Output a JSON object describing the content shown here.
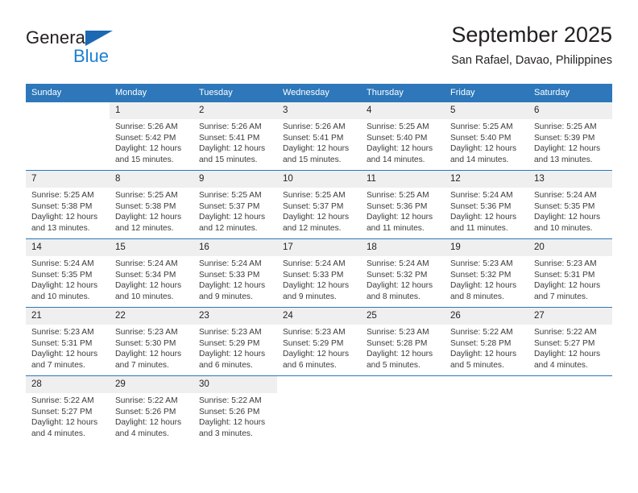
{
  "brand": {
    "name_top": "General",
    "name_bottom": "Blue",
    "triangle_color": "#1b69b3",
    "blue_color": "#1b7fd4"
  },
  "header": {
    "title": "September 2025",
    "subtitle": "San Rafael, Davao, Philippines"
  },
  "theme": {
    "header_bg": "#2d77ba",
    "daynum_bg": "#efefef",
    "text": "#231f20"
  },
  "weekdays": [
    "Sunday",
    "Monday",
    "Tuesday",
    "Wednesday",
    "Thursday",
    "Friday",
    "Saturday"
  ],
  "weeks": [
    [
      {
        "day": "",
        "lines": []
      },
      {
        "day": "1",
        "lines": [
          "Sunrise: 5:26 AM",
          "Sunset: 5:42 PM",
          "Daylight: 12 hours",
          "and 15 minutes."
        ]
      },
      {
        "day": "2",
        "lines": [
          "Sunrise: 5:26 AM",
          "Sunset: 5:41 PM",
          "Daylight: 12 hours",
          "and 15 minutes."
        ]
      },
      {
        "day": "3",
        "lines": [
          "Sunrise: 5:26 AM",
          "Sunset: 5:41 PM",
          "Daylight: 12 hours",
          "and 15 minutes."
        ]
      },
      {
        "day": "4",
        "lines": [
          "Sunrise: 5:25 AM",
          "Sunset: 5:40 PM",
          "Daylight: 12 hours",
          "and 14 minutes."
        ]
      },
      {
        "day": "5",
        "lines": [
          "Sunrise: 5:25 AM",
          "Sunset: 5:40 PM",
          "Daylight: 12 hours",
          "and 14 minutes."
        ]
      },
      {
        "day": "6",
        "lines": [
          "Sunrise: 5:25 AM",
          "Sunset: 5:39 PM",
          "Daylight: 12 hours",
          "and 13 minutes."
        ]
      }
    ],
    [
      {
        "day": "7",
        "lines": [
          "Sunrise: 5:25 AM",
          "Sunset: 5:38 PM",
          "Daylight: 12 hours",
          "and 13 minutes."
        ]
      },
      {
        "day": "8",
        "lines": [
          "Sunrise: 5:25 AM",
          "Sunset: 5:38 PM",
          "Daylight: 12 hours",
          "and 12 minutes."
        ]
      },
      {
        "day": "9",
        "lines": [
          "Sunrise: 5:25 AM",
          "Sunset: 5:37 PM",
          "Daylight: 12 hours",
          "and 12 minutes."
        ]
      },
      {
        "day": "10",
        "lines": [
          "Sunrise: 5:25 AM",
          "Sunset: 5:37 PM",
          "Daylight: 12 hours",
          "and 12 minutes."
        ]
      },
      {
        "day": "11",
        "lines": [
          "Sunrise: 5:25 AM",
          "Sunset: 5:36 PM",
          "Daylight: 12 hours",
          "and 11 minutes."
        ]
      },
      {
        "day": "12",
        "lines": [
          "Sunrise: 5:24 AM",
          "Sunset: 5:36 PM",
          "Daylight: 12 hours",
          "and 11 minutes."
        ]
      },
      {
        "day": "13",
        "lines": [
          "Sunrise: 5:24 AM",
          "Sunset: 5:35 PM",
          "Daylight: 12 hours",
          "and 10 minutes."
        ]
      }
    ],
    [
      {
        "day": "14",
        "lines": [
          "Sunrise: 5:24 AM",
          "Sunset: 5:35 PM",
          "Daylight: 12 hours",
          "and 10 minutes."
        ]
      },
      {
        "day": "15",
        "lines": [
          "Sunrise: 5:24 AM",
          "Sunset: 5:34 PM",
          "Daylight: 12 hours",
          "and 10 minutes."
        ]
      },
      {
        "day": "16",
        "lines": [
          "Sunrise: 5:24 AM",
          "Sunset: 5:33 PM",
          "Daylight: 12 hours",
          "and 9 minutes."
        ]
      },
      {
        "day": "17",
        "lines": [
          "Sunrise: 5:24 AM",
          "Sunset: 5:33 PM",
          "Daylight: 12 hours",
          "and 9 minutes."
        ]
      },
      {
        "day": "18",
        "lines": [
          "Sunrise: 5:24 AM",
          "Sunset: 5:32 PM",
          "Daylight: 12 hours",
          "and 8 minutes."
        ]
      },
      {
        "day": "19",
        "lines": [
          "Sunrise: 5:23 AM",
          "Sunset: 5:32 PM",
          "Daylight: 12 hours",
          "and 8 minutes."
        ]
      },
      {
        "day": "20",
        "lines": [
          "Sunrise: 5:23 AM",
          "Sunset: 5:31 PM",
          "Daylight: 12 hours",
          "and 7 minutes."
        ]
      }
    ],
    [
      {
        "day": "21",
        "lines": [
          "Sunrise: 5:23 AM",
          "Sunset: 5:31 PM",
          "Daylight: 12 hours",
          "and 7 minutes."
        ]
      },
      {
        "day": "22",
        "lines": [
          "Sunrise: 5:23 AM",
          "Sunset: 5:30 PM",
          "Daylight: 12 hours",
          "and 7 minutes."
        ]
      },
      {
        "day": "23",
        "lines": [
          "Sunrise: 5:23 AM",
          "Sunset: 5:29 PM",
          "Daylight: 12 hours",
          "and 6 minutes."
        ]
      },
      {
        "day": "24",
        "lines": [
          "Sunrise: 5:23 AM",
          "Sunset: 5:29 PM",
          "Daylight: 12 hours",
          "and 6 minutes."
        ]
      },
      {
        "day": "25",
        "lines": [
          "Sunrise: 5:23 AM",
          "Sunset: 5:28 PM",
          "Daylight: 12 hours",
          "and 5 minutes."
        ]
      },
      {
        "day": "26",
        "lines": [
          "Sunrise: 5:22 AM",
          "Sunset: 5:28 PM",
          "Daylight: 12 hours",
          "and 5 minutes."
        ]
      },
      {
        "day": "27",
        "lines": [
          "Sunrise: 5:22 AM",
          "Sunset: 5:27 PM",
          "Daylight: 12 hours",
          "and 4 minutes."
        ]
      }
    ],
    [
      {
        "day": "28",
        "lines": [
          "Sunrise: 5:22 AM",
          "Sunset: 5:27 PM",
          "Daylight: 12 hours",
          "and 4 minutes."
        ]
      },
      {
        "day": "29",
        "lines": [
          "Sunrise: 5:22 AM",
          "Sunset: 5:26 PM",
          "Daylight: 12 hours",
          "and 4 minutes."
        ]
      },
      {
        "day": "30",
        "lines": [
          "Sunrise: 5:22 AM",
          "Sunset: 5:26 PM",
          "Daylight: 12 hours",
          "and 3 minutes."
        ]
      },
      {
        "day": "",
        "lines": []
      },
      {
        "day": "",
        "lines": []
      },
      {
        "day": "",
        "lines": []
      },
      {
        "day": "",
        "lines": []
      }
    ]
  ]
}
